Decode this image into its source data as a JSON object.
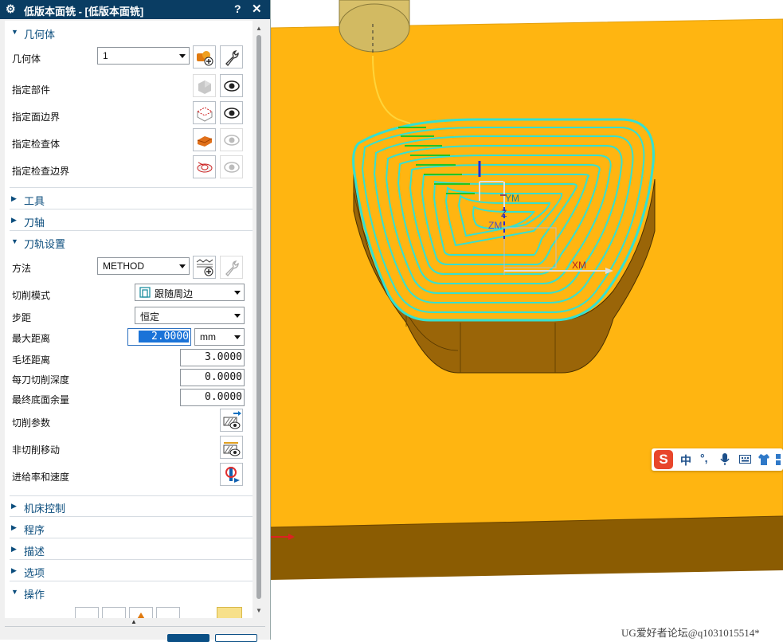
{
  "dialog": {
    "title": "低版本面铣 - [低版本面铣]",
    "help_label": "?",
    "close_label": "✕",
    "sections": {
      "geometry": "几何体",
      "tool": "工具",
      "tool_axis": "刀轴",
      "path_settings": "刀轨设置",
      "machine_control": "机床控制",
      "program": "程序",
      "description": "描述",
      "options": "选项",
      "actions": "操作"
    },
    "geometry": {
      "geometry_label": "几何体",
      "geometry_value": "1",
      "part_label": "指定部件",
      "face_boundary_label": "指定面边界",
      "check_body_label": "指定检查体",
      "check_boundary_label": "指定检查边界"
    },
    "path": {
      "method_label": "方法",
      "method_value": "METHOD",
      "cut_pattern_label": "切削模式",
      "cut_pattern_value": "跟随周边",
      "stepover_label": "步距",
      "stepover_value": "恒定",
      "max_distance_label": "最大距离",
      "max_distance_value": "2.0000",
      "max_distance_unit": "mm",
      "blank_distance_label": "毛坯距离",
      "blank_distance_value": "3.0000",
      "depth_per_cut_label": "每刀切削深度",
      "depth_per_cut_value": "0.0000",
      "final_floor_stock_label": "最终底面余量",
      "final_floor_stock_value": "0.0000",
      "cutting_params_label": "切削参数",
      "non_cutting_moves_label": "非切削移动",
      "feeds_speeds_label": "进给率和速度"
    }
  },
  "viewport": {
    "axis_labels": {
      "ym": "YM",
      "xm": "XM",
      "zm": "ZM",
      "z": "Z"
    },
    "colors": {
      "stock": "#ffb511",
      "side": "#8a5a00",
      "toolpath": "#35e0d0",
      "engage": "#22c422"
    }
  },
  "ime": {
    "logo": "S",
    "mode": "中",
    "punct": "°,"
  },
  "watermark": "UG爱好者论坛@q1031015514*"
}
